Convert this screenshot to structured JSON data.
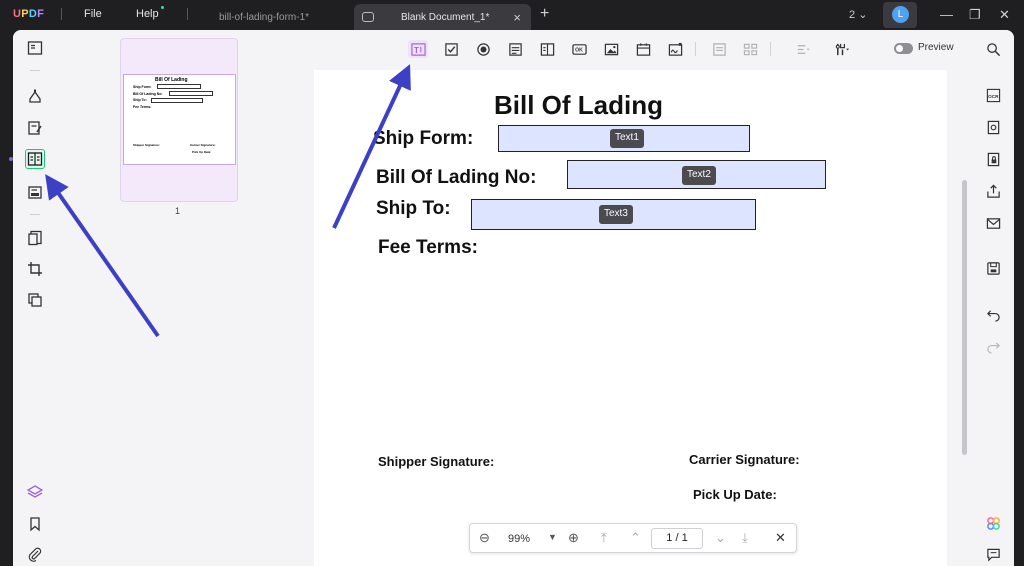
{
  "titlebar": {
    "logo": [
      "U",
      "P",
      "D",
      "F"
    ],
    "menus": [
      "File",
      "Help"
    ],
    "tabs": [
      {
        "label": "bill-of-lading-form-1*",
        "active": false
      },
      {
        "label": "Blank Document_1*",
        "active": true
      }
    ],
    "page_count": "2",
    "avatar_initial": "L"
  },
  "toolbar": {
    "preview_label": "Preview"
  },
  "document": {
    "title": "Bill Of Lading",
    "fields": [
      {
        "label": "Ship Form:",
        "tag": "Text1"
      },
      {
        "label": "Bill Of Lading No:",
        "tag": "Text2"
      },
      {
        "label": "Ship To:",
        "tag": "Text3"
      }
    ],
    "fee_terms": "Fee Terms:",
    "shipper_signature": "Shipper Signature:",
    "carrier_signature": "Carrier Signature:",
    "pick_up_date": "Pick Up Date:"
  },
  "thumbnail": {
    "page_number": "1",
    "title": "Bill Of Lading",
    "lines": [
      "Ship Form:",
      "Bill Of Lading No:",
      "Ship To:",
      "Fee Terms:"
    ],
    "footer_left": "Shipper Signature:",
    "footer_right": "Carrier Signature:",
    "footer_right2": "Pick Up Date:"
  },
  "zoom_bar": {
    "zoom": "99%",
    "page_indicator": "1 / 1"
  },
  "colors": {
    "accent": "#b178e8",
    "active_rail": "#1cc77a",
    "field_fill": "#dce4ff",
    "arrow": "#3b40c4"
  }
}
